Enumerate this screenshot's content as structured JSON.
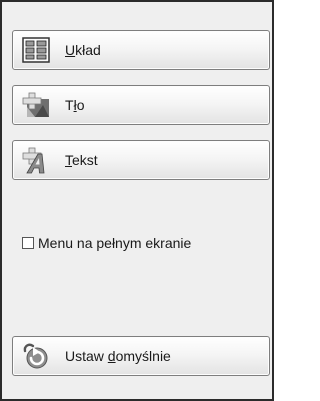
{
  "buttons": {
    "layout": {
      "pre": "",
      "mn": "U",
      "post": "kład",
      "icon": "layout-grid-icon"
    },
    "background": {
      "pre": "T",
      "mn": "ł",
      "post": "o",
      "icon": "background-image-icon"
    },
    "text": {
      "pre": "",
      "mn": "T",
      "post": "ekst",
      "icon": "text-style-icon"
    },
    "reset": {
      "pre": "Ustaw ",
      "mn": "d",
      "post": "omyślnie",
      "icon": "reset-arrow-icon"
    }
  },
  "fullscreen_menu": {
    "label": "Menu na pełnym ekranie",
    "checked": false
  }
}
